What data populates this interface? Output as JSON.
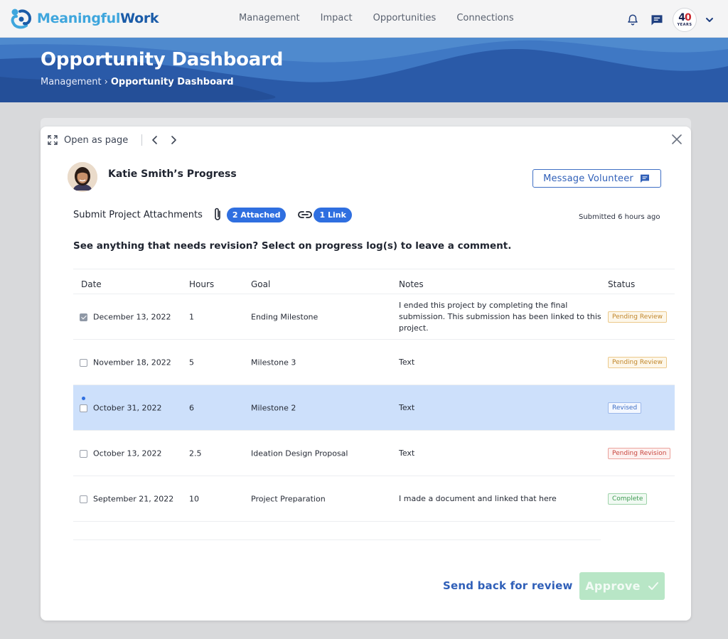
{
  "brand": {
    "name_part1": "Meaningful",
    "name_part2": "Work"
  },
  "nav": {
    "links": [
      "Management",
      "Impact",
      "Opportunities",
      "Connections"
    ]
  },
  "account": {
    "badge_number": "4",
    "badge_number_accent": "0",
    "badge_sub": "YEARS"
  },
  "hero": {
    "title": "Opportunity Dashboard",
    "breadcrumb_parent": "Management",
    "breadcrumb_sep": "›",
    "breadcrumb_current": "Opportunity Dashboard"
  },
  "modal": {
    "open_as_page": "Open as page",
    "volunteer_title": "Katie Smith’s Progress",
    "message_button": "Message Volunteer",
    "attachments_label": "Submit Project Attachments",
    "attached_chip": "2 Attached",
    "link_chip": "1 Link",
    "submitted": "Submitted 6 hours ago",
    "hint": "See anything that needs revision? Select on progress log(s) to leave a comment.",
    "send_back": "Send back for review",
    "approve": "Approve"
  },
  "table": {
    "headers": {
      "date": "Date",
      "hours": "Hours",
      "goal": "Goal",
      "notes": "Notes",
      "status": "Status"
    },
    "rows": [
      {
        "date": "December 13, 2022",
        "hours": "1",
        "goal": "Ending Milestone",
        "notes": "I ended this project by completing the final submission. This submission has been linked to this project.",
        "status": "Pending Review"
      },
      {
        "date": "November 18, 2022",
        "hours": "5",
        "goal": "Milestone 3",
        "notes": "Text",
        "status": "Pending Review"
      },
      {
        "date": "October 31, 2022",
        "hours": "6",
        "goal": "Milestone 2",
        "notes": "Text",
        "status": "Revised"
      },
      {
        "date": "October 13, 2022",
        "hours": "2.5",
        "goal": "Ideation Design Proposal",
        "notes": "Text",
        "status": "Pending Revision"
      },
      {
        "date": "September 21, 2022",
        "hours": "10",
        "goal": "Project Preparation",
        "notes": "I made a document and linked that here",
        "status": "Complete"
      }
    ]
  },
  "colors": {
    "brand_light": "#3fa6dd",
    "brand_dark": "#1a5ba8",
    "hero_blue": "#2a5aa8",
    "accent_blue": "#2f6fe0",
    "selected_row": "#cde0fb",
    "approve_disabled": "#b8e6c6"
  },
  "icons": [
    "logo-icon",
    "bell-icon",
    "chat-icon",
    "chevron-down-icon",
    "expand-icon",
    "chevron-left-icon",
    "chevron-right-icon",
    "close-icon",
    "message-icon",
    "paperclip-icon",
    "link-icon",
    "check-icon"
  ]
}
